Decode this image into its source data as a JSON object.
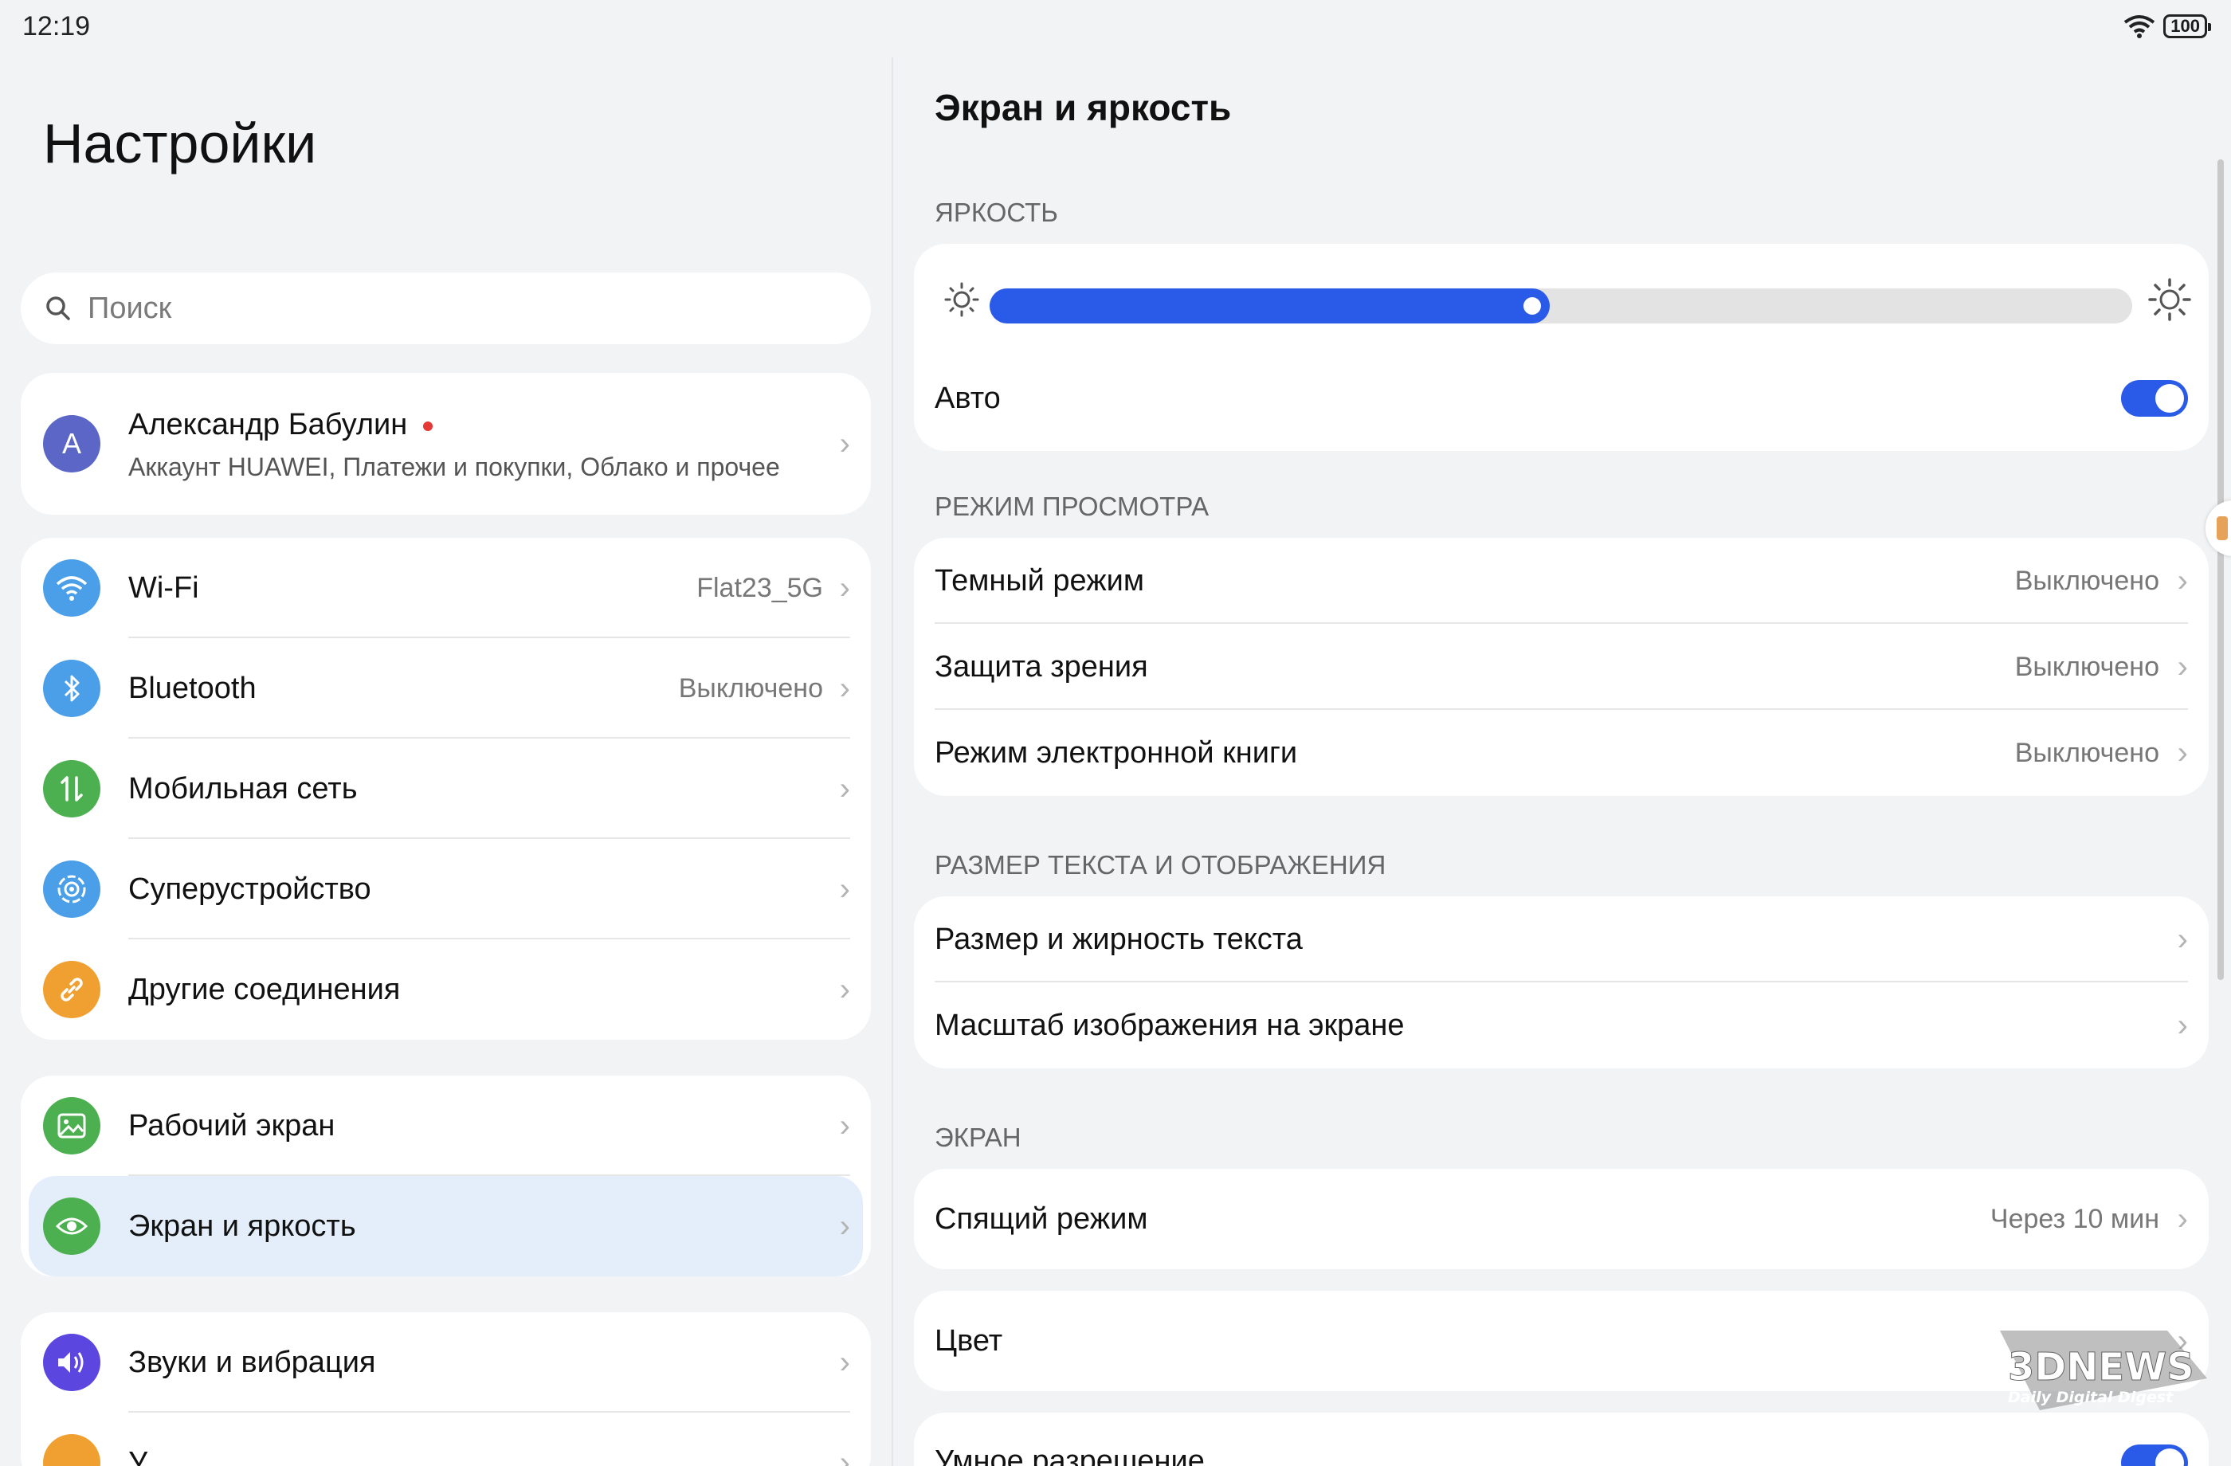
{
  "status": {
    "time": "12:19",
    "battery": "100"
  },
  "left": {
    "title": "Настройки",
    "search_placeholder": "Поиск",
    "account": {
      "initial": "A",
      "name": "Александр Бабулин",
      "subtitle": "Аккаунт HUAWEI, Платежи и покупки, Облако и прочее"
    },
    "connections": [
      {
        "label": "Wi-Fi",
        "value": "Flat23_5G",
        "icon": "wifi-icon",
        "color": "#4a9fe8"
      },
      {
        "label": "Bluetooth",
        "value": "Выключено",
        "icon": "bluetooth-icon",
        "color": "#4a9fe8"
      },
      {
        "label": "Мобильная сеть",
        "value": "",
        "icon": "mobile-network-icon",
        "color": "#4caf50"
      },
      {
        "label": "Суперустройство",
        "value": "",
        "icon": "super-device-icon",
        "color": "#4a9fe8"
      },
      {
        "label": "Другие соединения",
        "value": "",
        "icon": "link-icon",
        "color": "#f0a030"
      }
    ],
    "display_group": [
      {
        "label": "Рабочий экран",
        "icon": "home-screen-icon",
        "color": "#4caf50"
      },
      {
        "label": "Экран и яркость",
        "icon": "eye-icon",
        "color": "#4caf50"
      }
    ],
    "sound_group": [
      {
        "label": "Звуки и вибрация",
        "icon": "sound-icon",
        "color": "#5b46e0"
      },
      {
        "label": "У",
        "icon": "notifications-icon",
        "color": "#f0a030"
      }
    ]
  },
  "right": {
    "title": "Экран и яркость",
    "brightness": {
      "header": "ЯРКОСТЬ",
      "level_fraction": 0.49,
      "auto_label": "Авто",
      "auto_on": true
    },
    "view_mode": {
      "header": "РЕЖИМ ПРОСМОТРА",
      "items": [
        {
          "label": "Темный режим",
          "value": "Выключено"
        },
        {
          "label": "Защита зрения",
          "value": "Выключено"
        },
        {
          "label": "Режим электронной книги",
          "value": "Выключено"
        }
      ]
    },
    "text_size": {
      "header": "РАЗМЕР ТЕКСТА И ОТОБРАЖЕНИЯ",
      "items": [
        {
          "label": "Размер и жирность текста"
        },
        {
          "label": "Масштаб изображения на экране"
        }
      ]
    },
    "screen": {
      "header": "ЭКРАН",
      "sleep_label": "Спящий режим",
      "sleep_value": "Через 10 мин",
      "color_label": "Цвет",
      "smart_res_label": "Умное разрешение"
    }
  },
  "watermark": {
    "line1": "3DNEWS",
    "line2": "Daily Digital Digest"
  },
  "colors": {
    "accent": "#2a5ae8",
    "background": "#f1f3f5",
    "selected_row": "#e3eefa"
  }
}
